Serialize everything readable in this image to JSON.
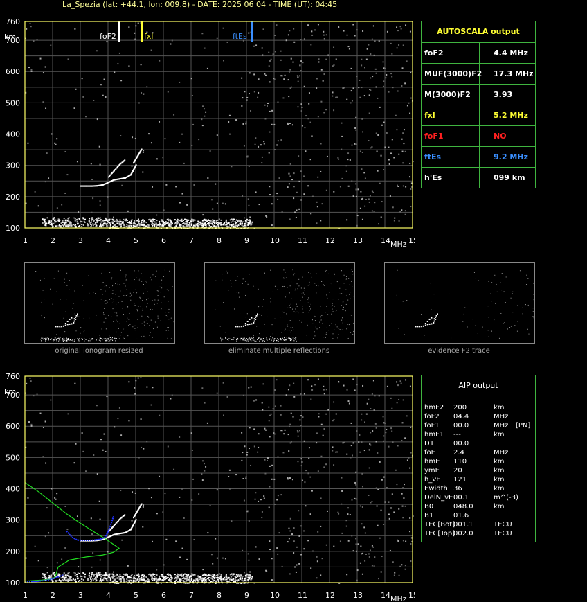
{
  "header": {
    "title": "La_Spezia (lat: +44.1, lon: 009.8) - DATE: 2025 06 04 - TIME (UT): 04:45"
  },
  "autoscala": {
    "title": "AUTOSCALA output",
    "rows": [
      {
        "key": "foF2",
        "value": "4.4 MHz",
        "key_color": "#ffffff",
        "value_color": "#ffffff"
      },
      {
        "key": "MUF(3000)F2",
        "value": "17.3 MHz",
        "key_color": "#ffffff",
        "value_color": "#ffffff"
      },
      {
        "key": "M(3000)F2",
        "value": "3.93",
        "key_color": "#ffffff",
        "value_color": "#ffffff"
      },
      {
        "key": "fxl",
        "value": "5.2 MHz",
        "key_color": "#ffff33",
        "value_color": "#ffff33"
      },
      {
        "key": "foF1",
        "value": "NO",
        "key_color": "#ff2020",
        "value_color": "#ff2020"
      },
      {
        "key": "ftEs",
        "value": "9.2 MHz",
        "key_color": "#3a8fff",
        "value_color": "#3a8fff"
      },
      {
        "key": "h'Es",
        "value": "099    km",
        "key_color": "#ffffff",
        "value_color": "#ffffff"
      }
    ]
  },
  "aip": {
    "title": "AIP output",
    "rows": [
      [
        "hmF2",
        "200",
        "km",
        ""
      ],
      [
        "foF2",
        "04.4",
        "MHz",
        ""
      ],
      [
        "foF1",
        "00.0",
        "MHz",
        "[PN]"
      ],
      [
        "hmF1",
        "---",
        "km",
        ""
      ],
      [
        "D1",
        "00.0",
        "",
        ""
      ],
      [
        "foE",
        "2.4",
        "MHz",
        ""
      ],
      [
        "hmE",
        "110",
        "km",
        ""
      ],
      [
        "ymE",
        "20",
        "km",
        ""
      ],
      [
        "h_vE",
        "121",
        "km",
        ""
      ],
      [
        "Ewidth",
        "36",
        "km",
        ""
      ],
      [
        "DelN_vE",
        "00.1",
        "m^(-3)",
        ""
      ],
      [
        "B0",
        "048.0",
        "km",
        ""
      ],
      [
        "B1",
        "01.6",
        "",
        ""
      ],
      [
        "TEC[Bot]",
        "001.1",
        "TECU",
        ""
      ],
      [
        "TEC[Top]",
        "002.0",
        "TECU",
        ""
      ]
    ]
  },
  "thumbnails": [
    {
      "caption": "original ionogram resized"
    },
    {
      "caption": "eliminate multiple reflections"
    },
    {
      "caption": "evidence F2 trace"
    }
  ],
  "chart_data": [
    {
      "type": "scatter",
      "title": "",
      "xlabel": "MHz",
      "ylabel": "km",
      "xlim": [
        1,
        15
      ],
      "ylim": [
        100,
        760
      ],
      "xticks": [
        "1",
        "2",
        "3",
        "4",
        "5",
        "6",
        "7",
        "8",
        "9",
        "10",
        "11",
        "12",
        "13",
        "14",
        "15"
      ],
      "yticks": [
        "100",
        "200",
        "300",
        "400",
        "500",
        "600",
        "700",
        "760"
      ],
      "grid": true,
      "markers": [
        {
          "label": "foF2",
          "x": 4.4,
          "color": "#ffffff"
        },
        {
          "label": "fxl",
          "x": 5.2,
          "color": "#ffff33"
        },
        {
          "label": "ftEs",
          "x": 9.2,
          "color": "#3a8fff"
        }
      ],
      "series": [
        {
          "x": [
            3.0,
            3.2,
            3.4,
            3.6,
            3.8,
            4.0,
            4.2,
            4.4,
            4.6,
            4.8,
            4.9,
            5.0
          ],
          "y": [
            236,
            236,
            236,
            237,
            240,
            248,
            256,
            259,
            262,
            272,
            288,
            305
          ]
        },
        {
          "x": [
            4.0,
            4.2,
            4.4,
            4.6
          ],
          "y": [
            265,
            285,
            305,
            320
          ]
        },
        {
          "x": [
            4.9,
            5.0,
            5.1,
            5.2
          ],
          "y": [
            310,
            325,
            340,
            355
          ]
        }
      ],
      "es_trace": {
        "x_start": 1.6,
        "x_end": 9.2,
        "h": 112
      }
    },
    {
      "type": "line",
      "title": "",
      "xlabel": "MHz",
      "ylabel": "km",
      "xlim": [
        1,
        15
      ],
      "ylim": [
        100,
        760
      ],
      "xticks": [
        "1",
        "2",
        "3",
        "4",
        "5",
        "6",
        "7",
        "8",
        "9",
        "10",
        "11",
        "12",
        "13",
        "14",
        "15"
      ],
      "yticks": [
        "100",
        "200",
        "300",
        "400",
        "500",
        "600",
        "700",
        "760"
      ],
      "grid": true,
      "series": [
        {
          "color": "#22dd22",
          "x": [
            1.0,
            1.5,
            2.0,
            2.5,
            3.0,
            3.5,
            3.9,
            4.2,
            4.4,
            4.2,
            3.8,
            3.2,
            2.6,
            2.2,
            2.1,
            2.0,
            1.6,
            1.0
          ],
          "y": [
            420,
            390,
            355,
            320,
            290,
            262,
            240,
            222,
            210,
            197,
            188,
            182,
            172,
            150,
            120,
            112,
            108,
            105
          ]
        },
        {
          "color": "#2233ff",
          "x": [
            2.5,
            2.7,
            2.9,
            3.1,
            3.3,
            3.5,
            3.7,
            3.9,
            4.0,
            4.1,
            4.2
          ],
          "y": [
            265,
            245,
            236,
            235,
            235,
            236,
            238,
            245,
            262,
            285,
            312
          ]
        },
        {
          "color": "#2233ff",
          "x": [
            1.0,
            1.4,
            1.8,
            2.0,
            2.2,
            2.4
          ],
          "y": [
            103,
            104,
            108,
            112,
            118,
            125
          ]
        }
      ]
    }
  ]
}
